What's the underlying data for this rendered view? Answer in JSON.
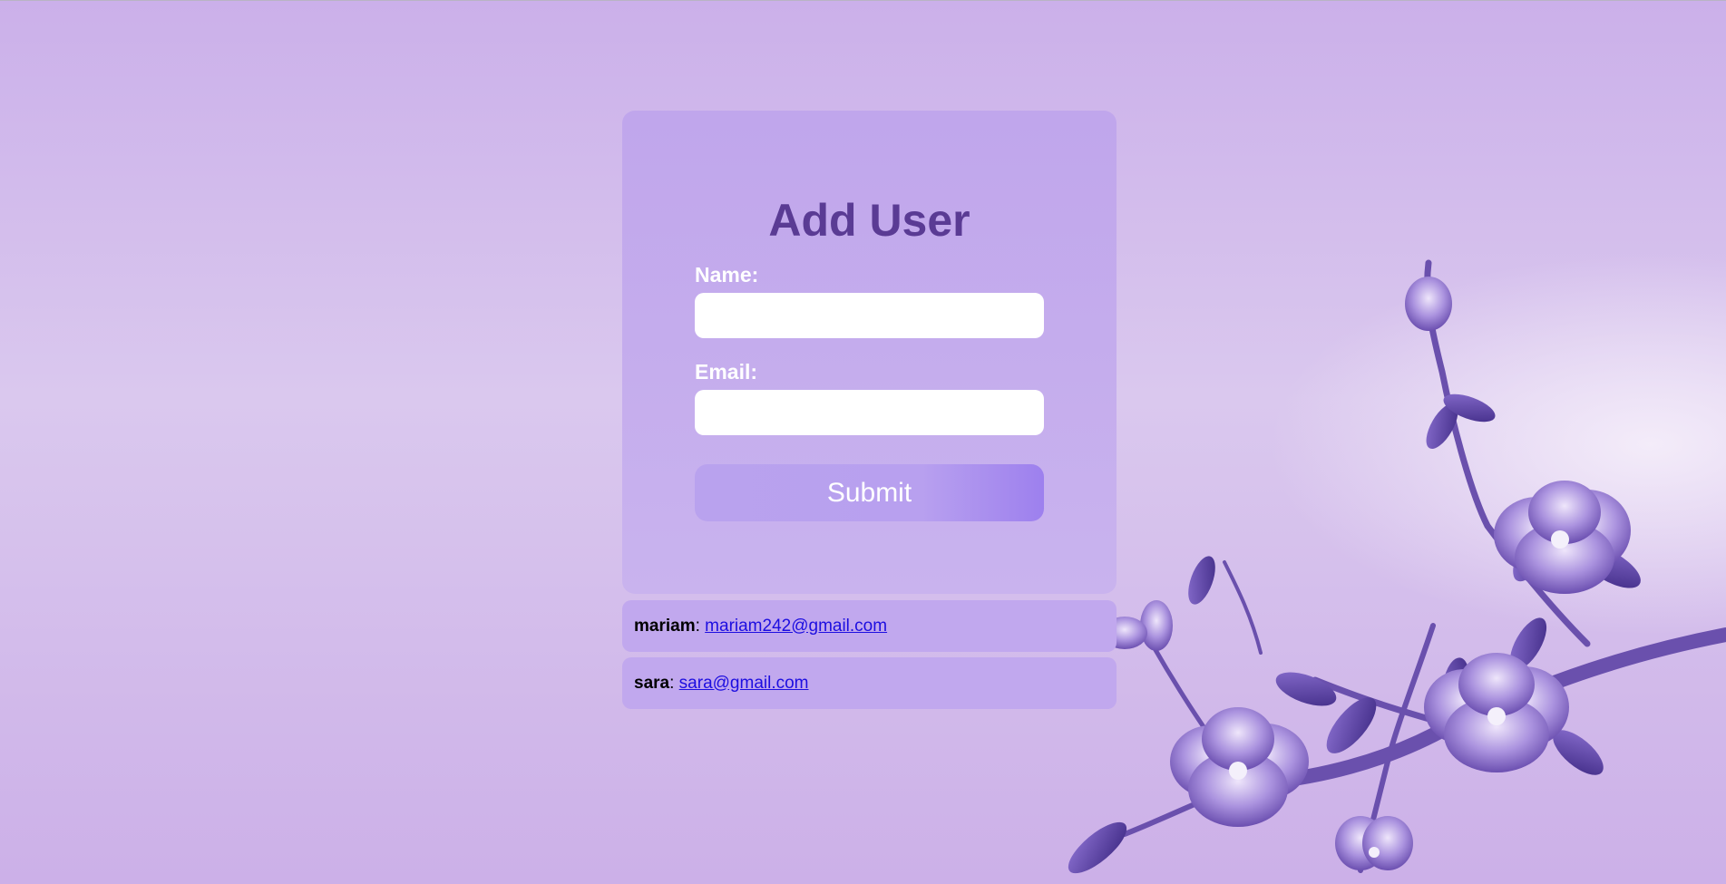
{
  "form": {
    "title": "Add User",
    "name_label": "Name:",
    "name_value": "",
    "email_label": "Email:",
    "email_value": "",
    "submit_label": "Submit"
  },
  "users": [
    {
      "name": "mariam",
      "separator": ":",
      "email": "mariam242@gmail.com"
    },
    {
      "name": "sara",
      "separator": ":",
      "email": "sara@gmail.com"
    }
  ],
  "colors": {
    "card": "#c0a6ec",
    "title": "#5a3b94",
    "link": "#1d0ee0",
    "flower": "#8e74cc"
  },
  "decoration": "purple-flower-branch"
}
